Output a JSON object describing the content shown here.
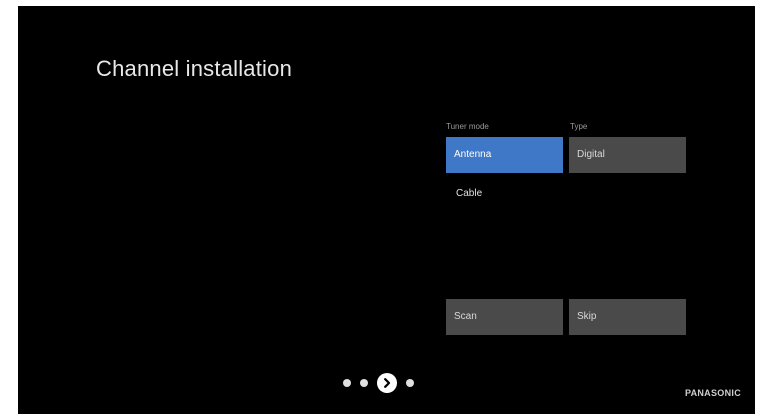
{
  "page": {
    "title": "Channel installation"
  },
  "tuner": {
    "label": "Tuner mode",
    "options": [
      "Antenna",
      "Cable"
    ],
    "selected": "Antenna"
  },
  "type": {
    "label": "Type",
    "value": "Digital"
  },
  "actions": {
    "scan_label": "Scan",
    "skip_label": "Skip"
  },
  "pagination": {
    "step_count": 4,
    "current_step": 3,
    "next_icon": "chevron-right-icon"
  },
  "brand": {
    "name": "PANASONIC"
  },
  "colors": {
    "background": "#000000",
    "selected": "#3f78c6",
    "tile": "#4a4a4a"
  }
}
